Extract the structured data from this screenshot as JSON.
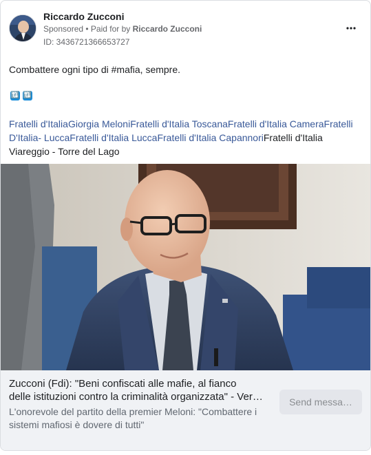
{
  "post": {
    "page_name": "Riccardo Zucconi",
    "sponsored_label": "Sponsored",
    "separator": " • ",
    "paid_for_label": "Paid for by ",
    "paid_for_name": "Riccardo Zucconi",
    "ad_id": "ID: 3436721366653727",
    "more_icon": "more-horizontal-icon",
    "text": "Combattere ogni tipo di #mafia, sempre.",
    "emojis": [
      "🔃",
      "🔃"
    ],
    "tags": [
      "Fratelli d'Italia",
      "Giorgia Meloni",
      "Fratelli d'Italia Toscana",
      "Fratelli d'Italia Camera",
      "Fratelli D'Italia- Lucca",
      "Fratelli d'Italia Lucca",
      "Fratelli d'Italia Capannori"
    ],
    "tag_plain": "Fratelli d'Italia Viareggio - Torre del Lago"
  },
  "link": {
    "headline_line1": "Zucconi (Fdi): \"Beni confiscati alle mafie, al fianco",
    "headline_line2": "delle istituzioni contro la criminalità organizzata\" - Versilia Today",
    "subtext": "L'onorevole del partito della premier Meloni: \"Combattere i sistemi mafiosi è dovere di tutti\"",
    "cta": "Send messa…"
  },
  "colors": {
    "link_blue": "#385898",
    "footer_bg": "#f0f2f5",
    "button_bg": "#e4e6eb"
  }
}
